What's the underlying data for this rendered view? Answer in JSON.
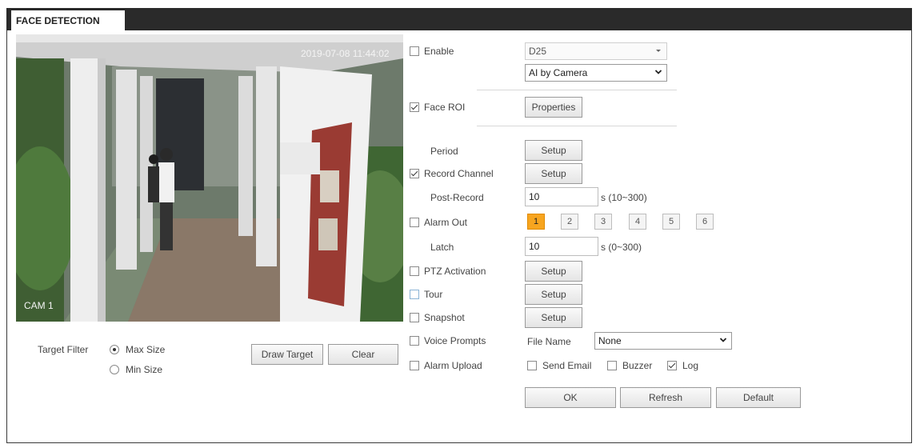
{
  "tab": {
    "title": "FACE DETECTION"
  },
  "video": {
    "timestamp": "2019-07-08 11:44:02",
    "channel_label": "CAM 1"
  },
  "target_filter": {
    "label": "Target Filter",
    "options": [
      "Max Size",
      "Min Size"
    ],
    "selected": "Max Size"
  },
  "buttons": {
    "draw_target": "Draw Target",
    "clear": "Clear",
    "properties": "Properties",
    "setup": "Setup",
    "ok": "OK",
    "refresh": "Refresh",
    "default": "Default"
  },
  "enable": {
    "label": "Enable",
    "checked": false,
    "channel_select": "D25",
    "mode_select": "AI by Camera"
  },
  "face_roi": {
    "label": "Face ROI",
    "checked": true
  },
  "period": {
    "label": "Period"
  },
  "record_channel": {
    "label": "Record Channel",
    "checked": true
  },
  "post_record": {
    "label": "Post-Record",
    "value": "10",
    "range": "s (10~300)"
  },
  "alarm_out": {
    "label": "Alarm Out",
    "checked": false,
    "outputs": [
      "1",
      "2",
      "3",
      "4",
      "5",
      "6"
    ],
    "active_output": "1"
  },
  "latch": {
    "label": "Latch",
    "value": "10",
    "range": "s (0~300)"
  },
  "ptz_activation": {
    "label": "PTZ Activation",
    "checked": false
  },
  "tour": {
    "label": "Tour",
    "checked": false
  },
  "snapshot": {
    "label": "Snapshot",
    "checked": false
  },
  "voice_prompts": {
    "label": "Voice Prompts",
    "checked": false,
    "file_name_label": "File Name",
    "file_name_value": "None"
  },
  "alarm_upload": {
    "label": "Alarm Upload",
    "checked": false
  },
  "send_email": {
    "label": "Send Email",
    "checked": false
  },
  "buzzer": {
    "label": "Buzzer",
    "checked": false
  },
  "log": {
    "label": "Log",
    "checked": true
  },
  "colors": {
    "header_bg": "#2a2a2a",
    "active_output": "#f7a51f",
    "border": "#3a3a3a"
  }
}
